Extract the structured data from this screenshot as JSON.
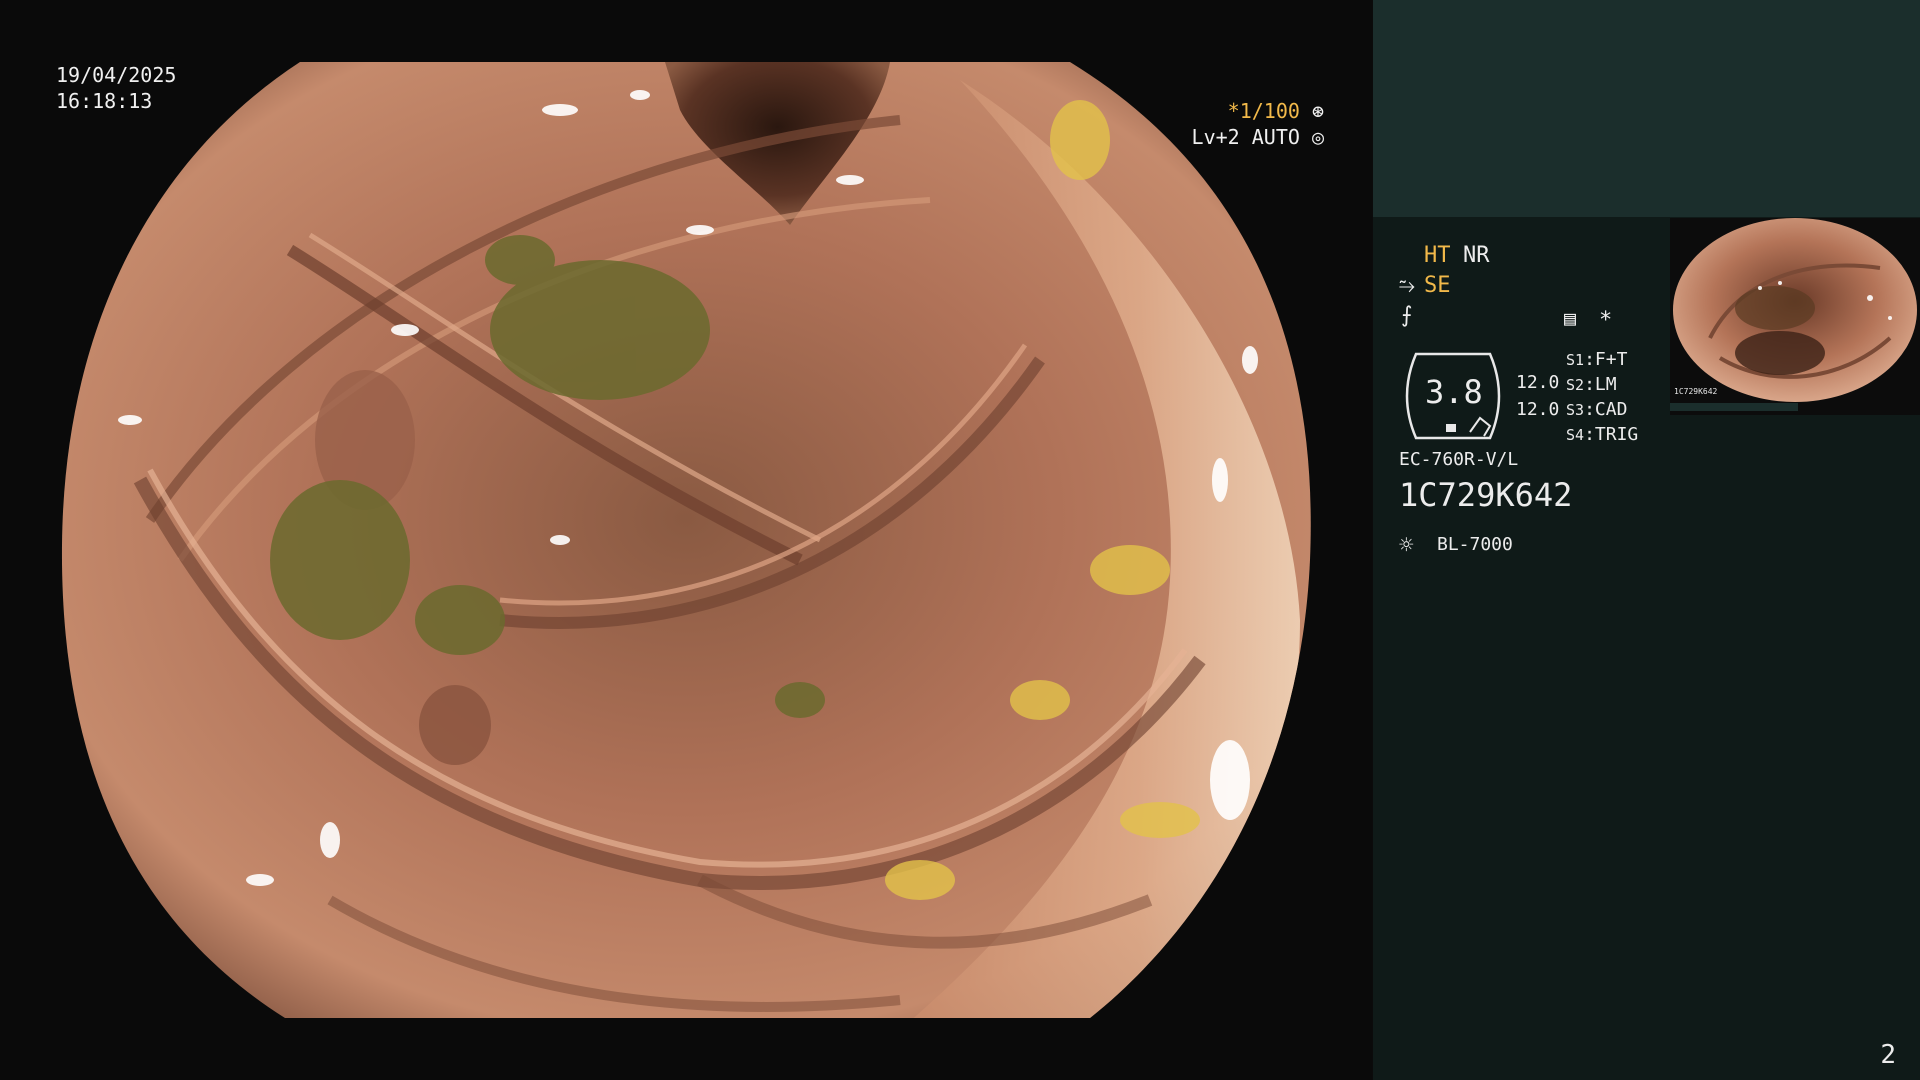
{
  "endoscope_view": {
    "date": "19/04/2025",
    "time": "16:18:13",
    "shutter_speed": "*1/100",
    "shutter_icon": "aperture-icon",
    "iris_mode": "Lv+2 AUTO",
    "iris_icon": "iris-icon",
    "scene": "colonoscopy lumen with haustral folds"
  },
  "side_panel": {
    "ht_label": "HT",
    "nr_label": "NR",
    "se_label": "SE",
    "se_icon": "scope-tip-icon",
    "freeze_icon": "freeze-icon",
    "menu_icon": "list-icon",
    "star": "*",
    "zoom_value": "3.8",
    "param1": "12.0",
    "param2": "12.0",
    "switches": [
      {
        "key": "S1",
        "value": "F+T"
      },
      {
        "key": "S2",
        "value": "LM"
      },
      {
        "key": "S3",
        "value": "CAD"
      },
      {
        "key": "S4",
        "value": "TRIG"
      }
    ],
    "scope_model": "EC-760R-V/L",
    "scope_serial": "1C729K642",
    "light_source_icon": "lamp-icon",
    "light_source": "BL-7000",
    "thumb_serial": "1C729K642",
    "page_number": "2"
  },
  "colors": {
    "accent_amber": "#f2b94a",
    "panel_bg": "#0f1a18",
    "panel_top": "#1b2e2c",
    "mucosa": "#b87a5e"
  }
}
